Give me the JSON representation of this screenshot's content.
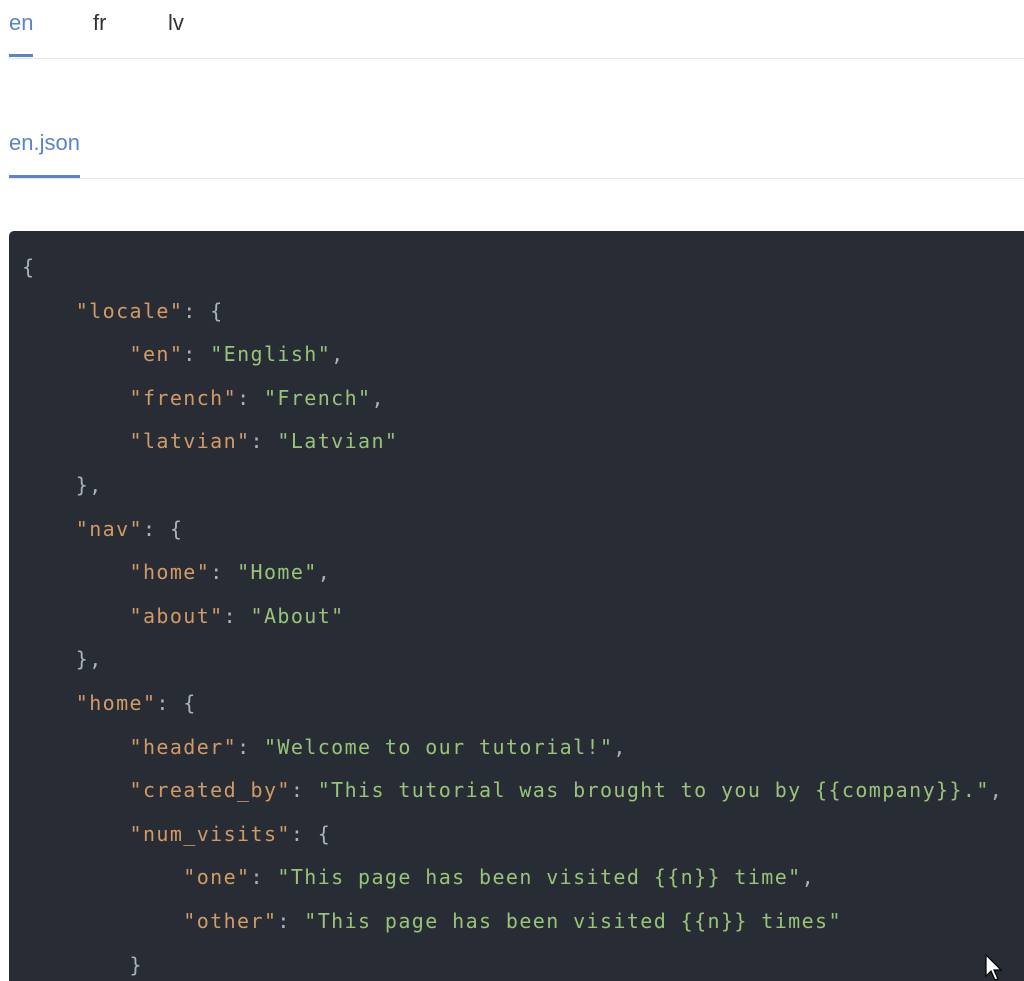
{
  "lang_tabs": [
    {
      "label": "en",
      "active": true
    },
    {
      "label": "fr",
      "active": false
    },
    {
      "label": "lv",
      "active": false
    }
  ],
  "file_tab": {
    "label": "en.json"
  },
  "colors": {
    "accent": "#5b84c6",
    "code_bg": "#282c34",
    "key": "#d19a66",
    "string": "#98c379",
    "punct": "#abb2bf"
  },
  "code_lines": [
    {
      "indent": 0,
      "tokens": [
        {
          "t": "{",
          "c": "p"
        }
      ]
    },
    {
      "indent": 1,
      "tokens": [
        {
          "t": "\"locale\"",
          "c": "k"
        },
        {
          "t": ": {",
          "c": "p"
        }
      ]
    },
    {
      "indent": 2,
      "tokens": [
        {
          "t": "\"en\"",
          "c": "k"
        },
        {
          "t": ": ",
          "c": "p"
        },
        {
          "t": "\"English\"",
          "c": "s"
        },
        {
          "t": ",",
          "c": "p"
        }
      ]
    },
    {
      "indent": 2,
      "tokens": [
        {
          "t": "\"french\"",
          "c": "k"
        },
        {
          "t": ": ",
          "c": "p"
        },
        {
          "t": "\"French\"",
          "c": "s"
        },
        {
          "t": ",",
          "c": "p"
        }
      ]
    },
    {
      "indent": 2,
      "tokens": [
        {
          "t": "\"latvian\"",
          "c": "k"
        },
        {
          "t": ": ",
          "c": "p"
        },
        {
          "t": "\"Latvian\"",
          "c": "s"
        }
      ]
    },
    {
      "indent": 1,
      "tokens": [
        {
          "t": "},",
          "c": "p"
        }
      ]
    },
    {
      "indent": 1,
      "tokens": [
        {
          "t": "\"nav\"",
          "c": "k"
        },
        {
          "t": ": {",
          "c": "p"
        }
      ]
    },
    {
      "indent": 2,
      "tokens": [
        {
          "t": "\"home\"",
          "c": "k"
        },
        {
          "t": ": ",
          "c": "p"
        },
        {
          "t": "\"Home\"",
          "c": "s"
        },
        {
          "t": ",",
          "c": "p"
        }
      ]
    },
    {
      "indent": 2,
      "tokens": [
        {
          "t": "\"about\"",
          "c": "k"
        },
        {
          "t": ": ",
          "c": "p"
        },
        {
          "t": "\"About\"",
          "c": "s"
        }
      ]
    },
    {
      "indent": 1,
      "tokens": [
        {
          "t": "},",
          "c": "p"
        }
      ]
    },
    {
      "indent": 1,
      "tokens": [
        {
          "t": "\"home\"",
          "c": "k"
        },
        {
          "t": ": {",
          "c": "p"
        }
      ]
    },
    {
      "indent": 2,
      "tokens": [
        {
          "t": "\"header\"",
          "c": "k"
        },
        {
          "t": ": ",
          "c": "p"
        },
        {
          "t": "\"Welcome to our tutorial!\"",
          "c": "s"
        },
        {
          "t": ",",
          "c": "p"
        }
      ]
    },
    {
      "indent": 2,
      "tokens": [
        {
          "t": "\"created_by\"",
          "c": "k"
        },
        {
          "t": ": ",
          "c": "p"
        },
        {
          "t": "\"This tutorial was brought to you by {{company}}.\"",
          "c": "s"
        },
        {
          "t": ",",
          "c": "p"
        }
      ]
    },
    {
      "indent": 2,
      "tokens": [
        {
          "t": "\"num_visits\"",
          "c": "k"
        },
        {
          "t": ": {",
          "c": "p"
        }
      ]
    },
    {
      "indent": 3,
      "tokens": [
        {
          "t": "\"one\"",
          "c": "k"
        },
        {
          "t": ": ",
          "c": "p"
        },
        {
          "t": "\"This page has been visited {{n}} time\"",
          "c": "s"
        },
        {
          "t": ",",
          "c": "p"
        }
      ]
    },
    {
      "indent": 3,
      "tokens": [
        {
          "t": "\"other\"",
          "c": "k"
        },
        {
          "t": ": ",
          "c": "p"
        },
        {
          "t": "\"This page has been visited {{n}} times\"",
          "c": "s"
        }
      ]
    },
    {
      "indent": 2,
      "tokens": [
        {
          "t": "}",
          "c": "p"
        }
      ]
    }
  ]
}
